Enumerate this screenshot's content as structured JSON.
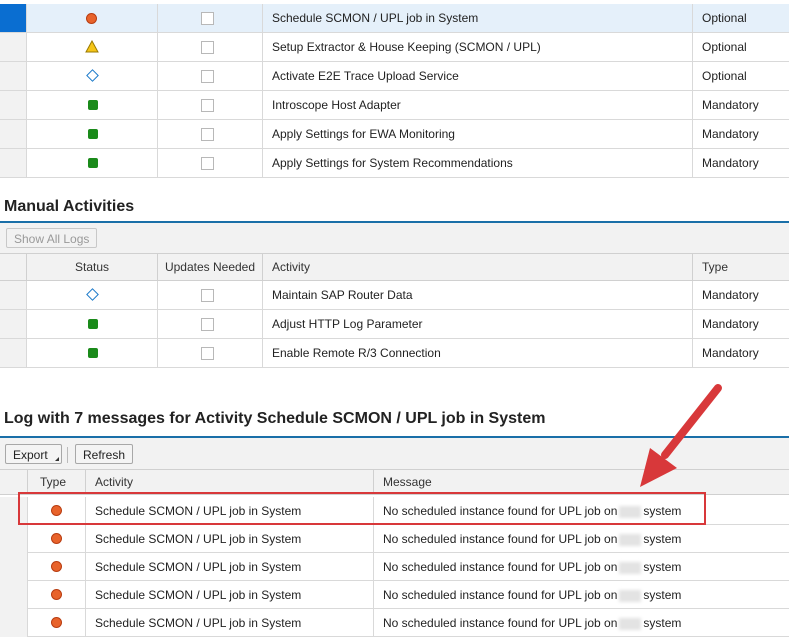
{
  "top_table": {
    "rows": [
      {
        "activity": "Schedule SCMON / UPL job in System",
        "type": "Optional",
        "status_icon": "red-circle-icon"
      },
      {
        "activity": "Setup Extractor & House Keeping (SCMON / UPL)",
        "type": "Optional",
        "status_icon": "warning-triangle-icon"
      },
      {
        "activity": "Activate E2E Trace Upload Service",
        "type": "Optional",
        "status_icon": "blue-diamond-icon"
      },
      {
        "activity": "Introscope Host Adapter",
        "type": "Mandatory",
        "status_icon": "green-square-icon"
      },
      {
        "activity": "Apply Settings for EWA Monitoring",
        "type": "Mandatory",
        "status_icon": "green-square-icon"
      },
      {
        "activity": "Apply Settings for System Recommendations",
        "type": "Mandatory",
        "status_icon": "green-square-icon"
      }
    ]
  },
  "manual_activities": {
    "title": "Manual Activities",
    "show_all_logs_label": "Show All Logs",
    "columns": {
      "status": "Status",
      "updates_needed": "Updates Needed",
      "activity": "Activity",
      "type": "Type"
    },
    "rows": [
      {
        "activity": "Maintain SAP Router Data",
        "type": "Mandatory",
        "status_icon": "blue-diamond-icon"
      },
      {
        "activity": "Adjust HTTP Log Parameter",
        "type": "Mandatory",
        "status_icon": "green-square-icon"
      },
      {
        "activity": "Enable Remote R/3 Connection",
        "type": "Mandatory",
        "status_icon": "green-square-icon"
      }
    ]
  },
  "log": {
    "title": "Log with 7 messages for Activity Schedule SCMON / UPL job in System",
    "export_label": "Export",
    "refresh_label": "Refresh",
    "columns": {
      "type": "Type",
      "activity": "Activity",
      "message": "Message"
    },
    "rows": [
      {
        "activity": "Schedule SCMON / UPL job in System",
        "message_pre": "No scheduled instance found for UPL job on",
        "message_post": "system"
      },
      {
        "activity": "Schedule SCMON / UPL job in System",
        "message_pre": "No scheduled instance found for UPL job on",
        "message_post": "system"
      },
      {
        "activity": "Schedule SCMON / UPL job in System",
        "message_pre": "No scheduled instance found for UPL job on",
        "message_post": "system"
      },
      {
        "activity": "Schedule SCMON / UPL job in System",
        "message_pre": "No scheduled instance found for UPL job on",
        "message_post": "system"
      },
      {
        "activity": "Schedule SCMON / UPL job in System",
        "message_pre": "No scheduled instance found for UPL job on",
        "message_post": "system"
      }
    ]
  },
  "colors": {
    "accent": "#1a6fa8",
    "selected_row": "#e5f0fa",
    "highlight": "#d8383a",
    "error": "#e8632b",
    "success": "#1a8a1a"
  }
}
